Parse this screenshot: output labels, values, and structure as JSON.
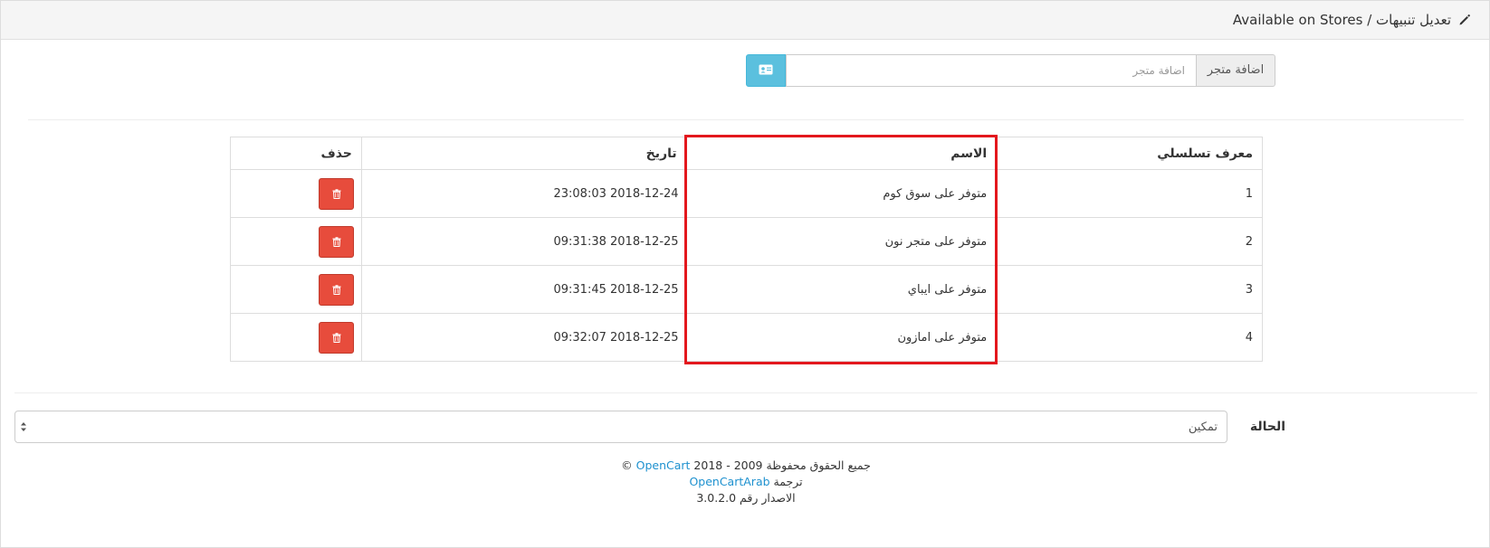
{
  "header": {
    "title": "تعديل تنبيهات / Available on Stores",
    "icon": "pencil-icon"
  },
  "add_store": {
    "label": "اضافة متجر",
    "placeholder": "اضافة متجر",
    "button_icon": "id-card-icon",
    "button_color": "#5bc0de"
  },
  "table": {
    "headers": {
      "id": "معرف تسلسلي",
      "name": "الاسم",
      "date": "تاريخ",
      "delete": "حذف"
    },
    "rows": [
      {
        "id": "1",
        "name": "متوفر على سوق كوم",
        "date": "2018-12-24 23:08:03"
      },
      {
        "id": "2",
        "name": "متوفر على متجر نون",
        "date": "2018-12-25 09:31:38"
      },
      {
        "id": "3",
        "name": "متوفر على ايباي",
        "date": "2018-12-25 09:31:45"
      },
      {
        "id": "4",
        "name": "متوفر على امازون",
        "date": "2018-12-25 09:32:07"
      }
    ],
    "delete_button_color": "#e74c3c",
    "highlight_color": "#e3171d"
  },
  "status": {
    "label": "الحالة",
    "selected": "تمكين"
  },
  "footer": {
    "copyright_prefix": "2018 - 2009 © ",
    "copyright_link": "OpenCart",
    "copyright_suffix": " جميع الحقوق محفوظة",
    "translation_prefix": "ترجمة ",
    "translation_link": "OpenCartArab",
    "version": "الاصدار رقم 3.0.2.0",
    "link_color": "#1e91cf"
  }
}
